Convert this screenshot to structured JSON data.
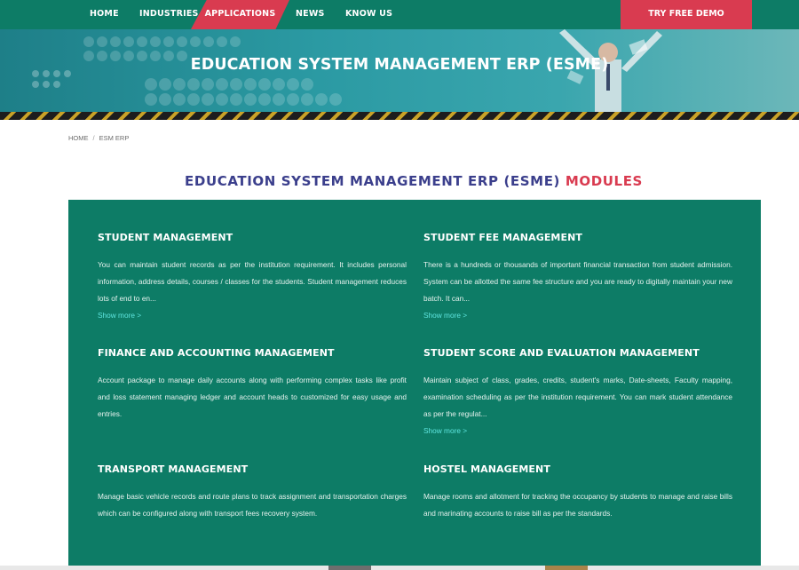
{
  "nav": {
    "items": [
      "HOME",
      "INDUSTRIES",
      "APPLICATIONS",
      "NEWS",
      "KNOW US"
    ],
    "demo_label": "TRY FREE DEMO",
    "active_color": "#d93b50",
    "bar_color": "#0d7c66"
  },
  "hero": {
    "title": "EDUCATION SYSTEM MANAGEMENT ERP (ESME)"
  },
  "breadcrumb": {
    "home": "HOME",
    "separator": "/",
    "current": "ESM ERP"
  },
  "section": {
    "title_main": "EDUCATION SYSTEM MANAGEMENT ERP (ESME)",
    "title_accent": "MODULES"
  },
  "modules": [
    {
      "title": "STUDENT MANAGEMENT",
      "text": "You can maintain student records as per the institution requirement. It includes personal information, address details, courses / classes for the students. Student management reduces lots of end to en...",
      "more": "Show more >"
    },
    {
      "title": "STUDENT FEE MANAGEMENT",
      "text": "There is a hundreds or thousands of important financial transaction from student admission. System can be allotted the same fee structure and you are ready to digitally maintain your new batch. It can...",
      "more": "Show more >"
    },
    {
      "title": "FINANCE AND ACCOUNTING MANAGEMENT",
      "text": "Account package to manage daily accounts along with performing complex tasks like profit and loss statement managing ledger and account heads to customized for easy usage and entries."
    },
    {
      "title": "STUDENT SCORE AND EVALUATION MANAGEMENT",
      "text": "Maintain subject of class, grades, credits, student's marks, Date-sheets, Faculty mapping, examination scheduling as per the institution requirement. You can mark student attendance as per the regulat...",
      "more": "Show more >"
    },
    {
      "title": "TRANSPORT MANAGEMENT",
      "text": "Manage basic vehicle records and route plans to track assignment and transportation charges which can be configured along with transport fees recovery system."
    },
    {
      "title": "HOSTEL MANAGEMENT",
      "text": "Manage rooms and allotment for tracking the occupancy by students to manage and raise bills and marinating accounts to raise bill as per the standards."
    }
  ]
}
